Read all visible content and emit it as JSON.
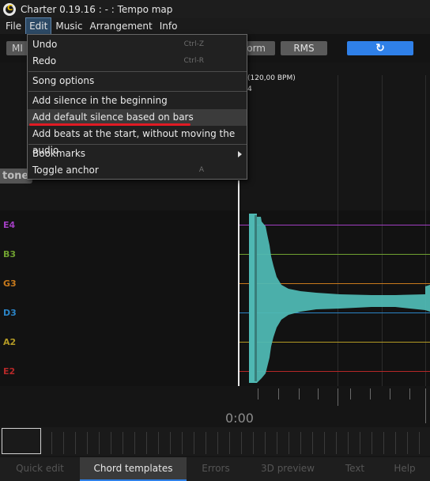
{
  "window": {
    "title": "Charter 0.19.16 :  -  : Tempo map",
    "logo_letter": "C"
  },
  "menubar": [
    "File",
    "Edit",
    "Music",
    "Arrangement",
    "Info"
  ],
  "toolbar": {
    "mi_label": "MI",
    "waveform_label": "orm",
    "rms_label": "RMS",
    "refresh_icon": "↻"
  },
  "tempo_marker": {
    "tempo": "(120,00 BPM)",
    "beat": "4"
  },
  "tone_tag": "tone",
  "lanes": [
    {
      "label": "E4",
      "color": "#a13ec1"
    },
    {
      "label": "B3",
      "color": "#6fa030"
    },
    {
      "label": "G3",
      "color": "#c87a1c"
    },
    {
      "label": "D3",
      "color": "#2b84c6"
    },
    {
      "label": "A2",
      "color": "#b39a25"
    },
    {
      "label": "E2",
      "color": "#b42828"
    }
  ],
  "waveform_color": "#4fb8b3",
  "timeline": {
    "time": "0:00"
  },
  "tabs": [
    {
      "label": "Quick edit",
      "active": false
    },
    {
      "label": "Chord templates",
      "active": true
    },
    {
      "label": "Errors",
      "active": false
    },
    {
      "label": "3D preview",
      "active": false
    },
    {
      "label": "Text",
      "active": false
    },
    {
      "label": "Help",
      "active": false
    }
  ],
  "edit_menu": {
    "undo": {
      "label": "Undo",
      "shortcut": "Ctrl-Z"
    },
    "redo": {
      "label": "Redo",
      "shortcut": "Ctrl-R"
    },
    "song_options": "Song options",
    "add_silence_beginning": "Add silence in the beginning",
    "add_default_silence": "Add default silence based on bars",
    "add_beats_start": "Add beats at the start, without moving the audio",
    "bookmarks": "Bookmarks",
    "toggle_anchor": {
      "label": "Toggle anchor",
      "shortcut": "A"
    }
  }
}
